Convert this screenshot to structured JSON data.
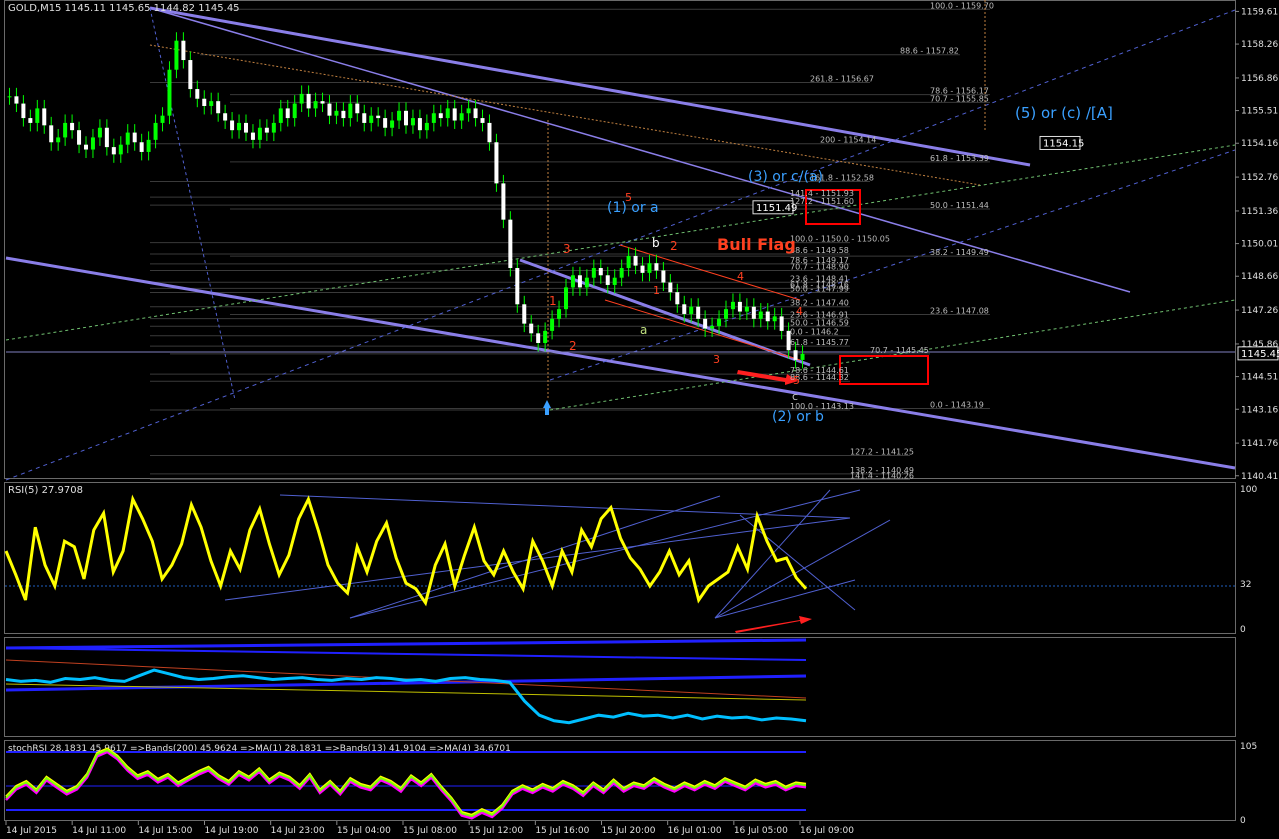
{
  "header": {
    "main": "GOLD,M15  1145.11 1145.65 1144.82 1145.45",
    "rsi": "RSI(5) 27.9708",
    "stochrsi": "stochRSI 28.1831 45.9617  =>Bands(200) 45.9624  =>MA(1) 28.1831  =>Bands(13) 41.9104  =>MA(4) 34.6701"
  },
  "colors": {
    "background": "#000000",
    "grid": "#2a2a2a",
    "candle_bull": "#00ff00",
    "candle_bear": "#ffffff",
    "trendline": "#8a7ee8",
    "wave_label": "#3aa0ff",
    "count_label": "#ff4020",
    "highlight_box": "#ff0000",
    "fib_text": "#bdbdbd",
    "rsi": "#ffff00",
    "cyan_line": "#00bfff",
    "stoch_magenta": "#ff00ff",
    "stoch_green": "#80ff00"
  },
  "chart_data": [
    {
      "type": "candlestick",
      "symbol": "GOLD",
      "timeframe": "M15",
      "ohlc_last": {
        "open": 1145.11,
        "high": 1145.65,
        "low": 1144.82,
        "close": 1145.45
      },
      "ylim": [
        1140.4,
        1160.0
      ],
      "y_ticks": [
        "1159.61",
        "1158.26",
        "1156.86",
        "1155.51",
        "1154.16",
        "1152.76",
        "1151.36",
        "1150.01",
        "1148.66",
        "1147.26",
        "1145.86",
        "1144.51",
        "1143.16",
        "1141.76",
        "1140.41"
      ],
      "x_ticks": [
        "14 Jul 2015",
        "14 Jul 11:00",
        "14 Jul 15:00",
        "14 Jul 19:00",
        "14 Jul 23:00",
        "15 Jul 04:00",
        "15 Jul 08:00",
        "15 Jul 12:00",
        "15 Jul 16:00",
        "15 Jul 20:00",
        "16 Jul 01:00",
        "16 Jul 05:00",
        "16 Jul 09:00"
      ],
      "price_flags": [
        "1154.15",
        "1151.49",
        "1145.45"
      ],
      "close_path": [
        1156.1,
        1155.8,
        1155.2,
        1155.0,
        1155.6,
        1154.9,
        1154.2,
        1154.4,
        1155.0,
        1154.7,
        1154.1,
        1153.9,
        1154.4,
        1154.8,
        1154.0,
        1153.7,
        1154.1,
        1154.6,
        1154.2,
        1153.8,
        1154.3,
        1155.0,
        1155.3,
        1157.2,
        1158.4,
        1157.6,
        1156.4,
        1156.0,
        1155.7,
        1155.9,
        1155.4,
        1155.1,
        1154.7,
        1155.0,
        1154.6,
        1154.3,
        1154.8,
        1154.6,
        1155.0,
        1155.6,
        1155.2,
        1155.8,
        1156.2,
        1155.6,
        1155.9,
        1155.8,
        1155.3,
        1155.5,
        1155.2,
        1155.8,
        1155.4,
        1155.0,
        1155.3,
        1155.2,
        1154.8,
        1155.1,
        1155.5,
        1154.9,
        1155.2,
        1154.7,
        1155.0,
        1155.4,
        1155.2,
        1155.6,
        1155.1,
        1155.4,
        1155.6,
        1155.2,
        1155.0,
        1154.2,
        1152.5,
        1151.0,
        1149.0,
        1147.5,
        1146.7,
        1146.3,
        1145.9,
        1146.4,
        1146.9,
        1147.3,
        1148.2,
        1148.7,
        1148.2,
        1148.6,
        1149.0,
        1148.7,
        1148.3,
        1148.6,
        1149.0,
        1149.5,
        1149.1,
        1148.8,
        1149.2,
        1148.9,
        1148.4,
        1148.0,
        1147.5,
        1147.1,
        1147.4,
        1146.9,
        1146.5,
        1146.6,
        1146.9,
        1147.3,
        1147.6,
        1147.2,
        1147.4,
        1146.9,
        1147.2,
        1146.8,
        1147.0,
        1146.4,
        1145.6,
        1145.2,
        1145.45
      ],
      "fib_labels": [
        "100.0 - 1159.70",
        "88.6 - 1157.82",
        "261.8 - 1156.67",
        "78.6 - 1156.17",
        "70.7 - 1155.85",
        "200 - 1154.14",
        "61.8 - 1153.39",
        "161.8 - 1152.58",
        "141.4 - 1151.93",
        "127.2 - 1151.60",
        "50.0 - 1151.44",
        "100.0 - 1150.0 - 1150.05",
        "88.6 - 1149.58",
        "38.2 - 1149.49",
        "78.6 - 1149.17",
        "70.7 - 1148.90",
        "23.6 - 1148.41",
        "61.8 - 1148.16",
        "50.0 - 1147.99",
        "38.2 - 1147.40",
        "23.6 - 1147.08",
        "23.6 - 1146.91",
        "50.0 - 1146.59",
        "0.0 - 1146.2",
        "61.8 - 1145.77",
        "70.7 - 1145.45",
        "78.6 - 1144.61",
        "88.6 - 1144.32",
        "100.0 - 1143.13",
        "0.0 - 1143.19",
        "127.2 - 1141.25",
        "138.2 - 1140.49",
        "141.4 - 1140.26"
      ],
      "annotations": [
        "(5) or (c) /[A]",
        "(3) or c/(a)",
        "(1) or a",
        "(2) or b",
        "Bull Flag",
        "b",
        "2",
        "5",
        "3",
        "1",
        "2",
        "3",
        "4",
        "5",
        "4",
        "1",
        "a",
        "c"
      ]
    },
    {
      "type": "line",
      "name": "RSI(5)",
      "ylim": [
        0,
        100
      ],
      "y_ticks": [
        "100",
        "32",
        "0"
      ],
      "values": [
        55,
        38,
        20,
        72,
        45,
        30,
        62,
        58,
        35,
        70,
        82,
        40,
        55,
        92,
        78,
        62,
        35,
        45,
        60,
        88,
        72,
        48,
        30,
        55,
        42,
        70,
        85,
        60,
        38,
        52,
        78,
        92,
        70,
        45,
        32,
        25,
        58,
        40,
        62,
        75,
        50,
        32,
        28,
        18,
        45,
        60,
        30,
        52,
        72,
        48,
        38,
        55,
        40,
        28,
        62,
        48,
        30,
        55,
        40,
        70,
        58,
        78,
        86,
        64,
        50,
        42,
        30,
        40,
        55,
        38,
        48,
        20,
        30,
        35,
        40,
        58,
        42,
        80,
        62,
        48,
        50,
        36,
        28
      ]
    },
    {
      "type": "line",
      "name": "oscillator-bands",
      "ylim": [
        -50,
        50
      ],
      "values": [
        8,
        6,
        7,
        5,
        9,
        8,
        10,
        7,
        6,
        12,
        18,
        14,
        10,
        8,
        9,
        11,
        12,
        10,
        8,
        9,
        10,
        8,
        7,
        9,
        8,
        10,
        9,
        7,
        8,
        6,
        9,
        10,
        8,
        7,
        5,
        -15,
        -30,
        -36,
        -38,
        -34,
        -30,
        -32,
        -28,
        -31,
        -30,
        -33,
        -30,
        -34,
        -31,
        -33,
        -32,
        -35,
        -33,
        -34,
        -36
      ]
    },
    {
      "type": "line",
      "name": "stochRSI",
      "ylim": [
        0,
        105
      ],
      "y_ticks": [
        "105",
        "0"
      ],
      "values": [
        30,
        45,
        52,
        40,
        58,
        48,
        38,
        45,
        62,
        92,
        98,
        88,
        72,
        60,
        66,
        55,
        62,
        50,
        58,
        66,
        72,
        60,
        52,
        66,
        58,
        70,
        54,
        64,
        58,
        46,
        62,
        40,
        52,
        38,
        56,
        48,
        44,
        58,
        52,
        42,
        60,
        50,
        62,
        44,
        28,
        8,
        4,
        12,
        6,
        18,
        38,
        46,
        40,
        48,
        42,
        52,
        46,
        36,
        50,
        40,
        54,
        42,
        50,
        46,
        56,
        48,
        42,
        50,
        44,
        52,
        46,
        56,
        50,
        44,
        54,
        48,
        52,
        44,
        50,
        48
      ]
    }
  ]
}
